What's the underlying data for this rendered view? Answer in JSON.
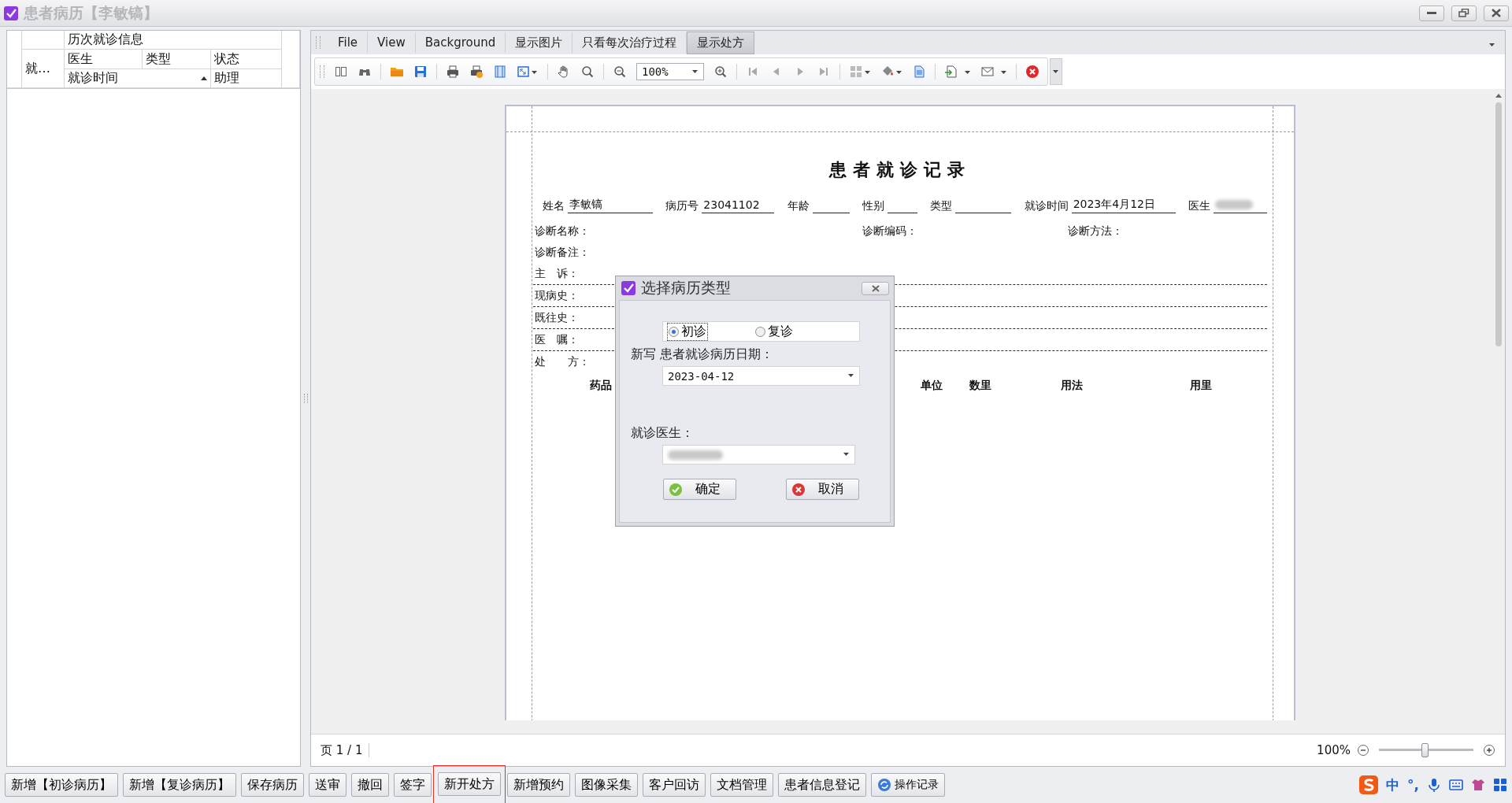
{
  "window": {
    "title": "患者病历【李敏镐】"
  },
  "visit_grid": {
    "group_header": "历次就诊信息",
    "row_header": "就…",
    "columns_row1": [
      "医生",
      "类型",
      "状态"
    ],
    "columns_row2": [
      {
        "label": "就诊时间",
        "sorted": true
      },
      {
        "label": "助理",
        "sorted": false
      }
    ]
  },
  "menu_tabs": [
    {
      "label": "File",
      "selected": false
    },
    {
      "label": "View",
      "selected": false
    },
    {
      "label": "Background",
      "selected": false
    },
    {
      "label": "显示图片",
      "selected": false
    },
    {
      "label": "只看每次治疗过程",
      "selected": false
    },
    {
      "label": "显示处方",
      "selected": true
    }
  ],
  "toolbar": {
    "zoom": "100%"
  },
  "document": {
    "title": "患者就诊记录",
    "header_fields": [
      {
        "label": "姓名",
        "value": "李敏镐"
      },
      {
        "label": "病历号",
        "value": "23041102"
      },
      {
        "label": "年龄"
      },
      {
        "label": "性别"
      },
      {
        "label": "类型"
      },
      {
        "label": "就诊时间",
        "value": "2023年4月12日"
      },
      {
        "label": "医生",
        "redacted": true
      }
    ],
    "diagnosis_row": [
      "诊断名称：",
      "诊断编码：",
      "诊断方法："
    ],
    "sections": [
      {
        "label": "诊断备注：",
        "dashed": false
      },
      {
        "label": "主　诉：",
        "dashed": true
      },
      {
        "label": "现病史：",
        "dashed": true
      },
      {
        "label": "既往史：",
        "dashed": true
      },
      {
        "label": "医　嘱：",
        "dashed": true
      },
      {
        "label": "处　　方：",
        "dashed": false
      }
    ],
    "prescription_columns": [
      "药品",
      "单位",
      "数里",
      "用法",
      "用里"
    ]
  },
  "status_bar": {
    "page": "页 1 / 1",
    "zoom": "100%",
    "zoom_slider": {
      "level": 0.48
    }
  },
  "action_buttons": [
    {
      "label": "新增【初诊病历】",
      "kind": "text",
      "highlighted": false
    },
    {
      "label": "新增【复诊病历】",
      "kind": "text",
      "highlighted": false
    },
    {
      "label": "保存病历",
      "kind": "text",
      "highlighted": false
    },
    {
      "label": "送审",
      "kind": "text",
      "highlighted": false
    },
    {
      "label": "撤回",
      "kind": "text",
      "highlighted": false
    },
    {
      "label": "签字",
      "kind": "text",
      "highlighted": false
    },
    {
      "label": "新开处方",
      "kind": "text",
      "highlighted": true
    },
    {
      "label": "新增预约",
      "kind": "text",
      "highlighted": false
    },
    {
      "label": "图像采集",
      "kind": "text",
      "highlighted": false
    },
    {
      "label": "客户回访",
      "kind": "text",
      "highlighted": false
    },
    {
      "label": "文档管理",
      "kind": "text",
      "highlighted": false
    },
    {
      "label": "患者信息登记",
      "kind": "text",
      "highlighted": false
    },
    {
      "label": "操作记录",
      "kind": "icon",
      "highlighted": false
    }
  ],
  "ime": {
    "mode": "中",
    "punctuation": "°,"
  },
  "dialog": {
    "title": "选择病历类型",
    "visit_types": [
      {
        "label": "初诊",
        "selected": true
      },
      {
        "label": "复诊",
        "selected": false
      }
    ],
    "date_label": "新写 患者就诊病历日期：",
    "date_value": "2023-04-12",
    "doctor": {
      "label": "就诊医生：",
      "redacted": true
    },
    "buttons": [
      {
        "label": "确定",
        "kind": "ok"
      },
      {
        "label": "取消",
        "kind": "cancel"
      }
    ]
  }
}
